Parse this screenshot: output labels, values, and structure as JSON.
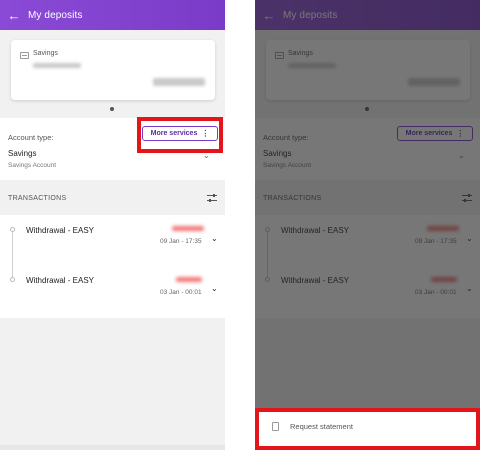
{
  "app": {
    "title": "My deposits",
    "back_icon": "arrow-left-icon",
    "accent_color": "#7a3cc8",
    "highlight_color": "#e3141a"
  },
  "card": {
    "label": "Savings",
    "icon": "card-icon"
  },
  "account": {
    "type_label": "Account type:",
    "value": "Savings",
    "subvalue": "Savings Account",
    "dropdown_icon": "chevron-down-icon"
  },
  "more_services": {
    "label": "More services",
    "icon": "kebab-icon"
  },
  "transactions": {
    "header": "TRANSACTIONS",
    "filter_icon": "filter-sliders-icon",
    "items": [
      {
        "name": "Withdrawal - EASY",
        "date": "09 Jan - 17:35"
      },
      {
        "name": "Withdrawal - EASY",
        "date": "03 Jan - 00:01"
      }
    ]
  },
  "sheet": {
    "label": "Request statement",
    "icon": "document-icon"
  }
}
